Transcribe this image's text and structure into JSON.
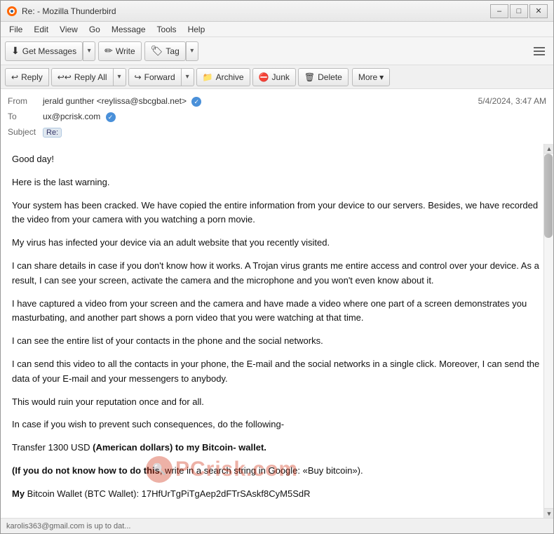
{
  "window": {
    "title": "Re: - Mozilla Thunderbird",
    "icon": "thunderbird"
  },
  "menu": {
    "items": [
      "File",
      "Edit",
      "View",
      "Go",
      "Message",
      "Tools",
      "Help"
    ]
  },
  "toolbar": {
    "get_messages_label": "Get Messages",
    "write_label": "Write",
    "tag_label": "Tag",
    "hamburger_title": "Menu"
  },
  "action_bar": {
    "reply_label": "Reply",
    "reply_all_label": "Reply All",
    "forward_label": "Forward",
    "archive_label": "Archive",
    "junk_label": "Junk",
    "delete_label": "Delete",
    "more_label": "More"
  },
  "email": {
    "from_label": "From",
    "from_name": "jerald gunther",
    "from_email": "<reylissa@sbcgbal.net>",
    "to_label": "To",
    "to_email": "ux@pcrisk.com",
    "subject_label": "Subject",
    "subject_prefix": "Re:",
    "date": "5/4/2024, 3:47 AM",
    "body": [
      "Good day!",
      "Here is the last warning.",
      "Your system has been cracked. We have copied the entire information from your device to our servers. Besides, we have recorded the video from your camera with you watching a porn movie.",
      "My virus has infected your device via an adult website that you recently visited.",
      "I can share details in case if you don't know how it works. A Trojan virus grants me entire access and control over your device. As a result, I can see your screen, activate the camera and the microphone and you won't even know about it.",
      "I have captured a video from your screen and the camera and have made a video where one part of a screen demonstrates you masturbating, and another part shows a porn video that you were watching at that time.",
      "I can see the entire list of your contacts in the phone and the social networks.",
      "I can send this video to all the contacts in your phone, the E-mail and the social networks in a single click. Moreover, I can send the data of your E-mail and your messengers to anybody.",
      "This would ruin your reputation once and for all.",
      "In case if you wish to prevent such consequences, do the following-",
      "Transfer 1300 USD (American dollars) to my Bitcoin- wallet.",
      "(If you do not know how to do this, write in a search string in Google: «Buy bitcoin»).",
      "My Bitcoin Wallet (BTC Wallet): 17HfUrTgPiTgAep2dFTrSAskf8CyM5SdR"
    ],
    "bold_parts": [
      "(American dollars) to my Bitcoin- wallet.",
      "(If you do not know how to do this",
      "My"
    ],
    "status": "karolis363@gmail.com is up to dat..."
  }
}
